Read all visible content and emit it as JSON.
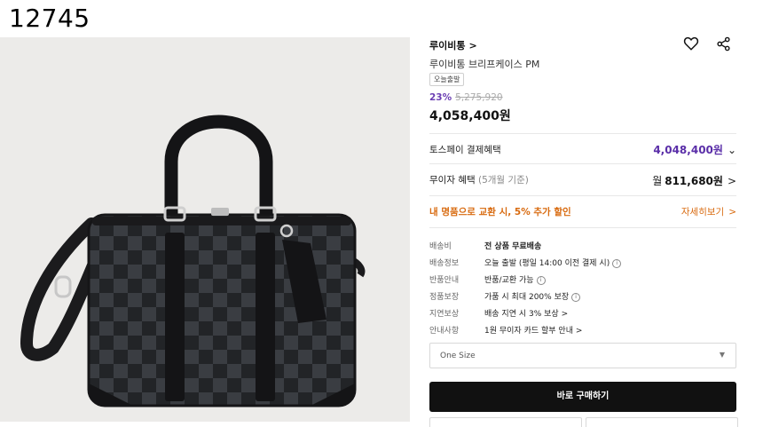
{
  "header": {
    "id_text": "12745"
  },
  "product": {
    "brand": "루이비통",
    "brand_chevron": ">",
    "name": "루이비통 브리프케이스 PM",
    "badge": "오늘출발",
    "discount_pct": "23%",
    "original_price": "5,275,920",
    "price": "4,058,400원"
  },
  "payments": {
    "toss_label": "토스페이 결제혜택",
    "toss_value": "4,048,400원",
    "installment_label": "무이자 혜택",
    "installment_sub": "(5개월 기준)",
    "installment_prefix": "월",
    "installment_value": "811,680원",
    "trade_in_label": "내 명품으로 교환 시, 5% 추가 할인",
    "trade_in_link": "자세히보기",
    "chevron": ">"
  },
  "info": [
    {
      "key": "배송비",
      "value": "전 상품 무료배송",
      "bold": true,
      "icon": ""
    },
    {
      "key": "배송정보",
      "value": "오늘 출발 (평일 14:00 이전 결제 시)",
      "bold": false,
      "icon": "info-icon"
    },
    {
      "key": "반품안내",
      "value": "반품/교환 가능",
      "bold": false,
      "icon": "info-icon"
    },
    {
      "key": "정품보장",
      "value": "가품 시 최대 200% 보장",
      "bold": false,
      "icon": "info-icon"
    },
    {
      "key": "지연보상",
      "value": "배송 지연 시 3% 보상",
      "bold": false,
      "icon": "chevron-right-icon"
    },
    {
      "key": "안내사항",
      "value": "1원 무이자 카드 할부 안내",
      "bold": false,
      "icon": "chevron-right-icon"
    }
  ],
  "option_select": {
    "value": "One Size",
    "arrow": "▼"
  },
  "buy_button": {
    "label": "바로 구매하기"
  },
  "icons": {
    "wishlist": "heart-icon",
    "share": "share-icon",
    "info": "info-icon",
    "info_glyph": "i",
    "chevron": ">"
  },
  "colors": {
    "purple": "#5a2ea8",
    "discount_purple": "#6b3fb3",
    "orange": "#d86a0f",
    "buy_bg": "#111111"
  }
}
